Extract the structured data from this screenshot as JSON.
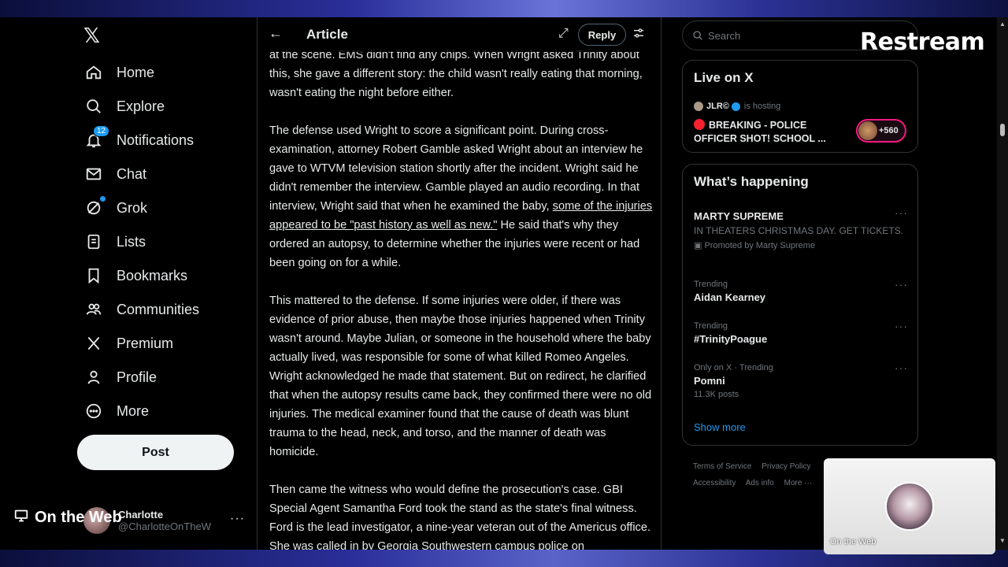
{
  "nav": {
    "items": [
      {
        "label": "Home",
        "icon": "home-icon"
      },
      {
        "label": "Explore",
        "icon": "search-icon"
      },
      {
        "label": "Notifications",
        "icon": "bell-icon",
        "badge": "12"
      },
      {
        "label": "Chat",
        "icon": "mail-icon"
      },
      {
        "label": "Grok",
        "icon": "grok-icon"
      },
      {
        "label": "Lists",
        "icon": "list-icon"
      },
      {
        "label": "Bookmarks",
        "icon": "bookmark-icon"
      },
      {
        "label": "Communities",
        "icon": "people-icon"
      },
      {
        "label": "Premium",
        "icon": "x-logo-icon"
      },
      {
        "label": "Profile",
        "icon": "person-icon"
      },
      {
        "label": "More",
        "icon": "more-circle-icon"
      }
    ],
    "post_label": "Post",
    "account": {
      "name": "Charlotte",
      "handle": "@CharlotteOnTheW"
    }
  },
  "article": {
    "header_title": "Article",
    "reply_label": "Reply",
    "p0": "at the scene. EMS didn't find any chips. When Wright asked Trinity about this, she gave a different story: the child wasn't really eating that morning, wasn't eating the night before either.",
    "p1_a": "The defense used Wright to score a significant point. During cross-examination, attorney Robert Gamble asked Wright about an interview he gave to WTVM television station shortly after the incident. Wright said he didn't remember the interview. Gamble played an audio recording. In that interview, Wright said that when he examined the baby, ",
    "p1_link": "some of the injuries appeared to be \"past history as well as new.\"",
    "p1_b": " He said that's why they ordered an autopsy, to determine whether the injuries were recent or had been going on for a while.",
    "p2": "This mattered to the defense. If some injuries were older, if there was evidence of prior abuse, then maybe those injuries happened when Trinity wasn't around. Maybe Julian, or someone in the household where the baby actually lived, was responsible for some of what killed Romeo Angeles. Wright acknowledged he made that statement. But on redirect, he clarified that when the autopsy results came back, they confirmed there were no old injuries. The medical examiner found that the cause of death was blunt trauma to the head, neck, and torso, and the manner of death was homicide.",
    "p3": "Then came the witness who would define the prosecution's case. GBI Special Agent Samantha Ford took the stand as the state's final witness. Ford is the lead investigator, a nine-year veteran out of the Americus office. She was called in by Georgia Southwestern campus police on"
  },
  "right": {
    "search_placeholder": "Search",
    "live": {
      "title": "Live on X",
      "host_name": "JLR©",
      "host_suffix": "is hosting",
      "text": "BREAKING - POLICE OFFICER SHOT! SCHOOL ...",
      "listeners": "+560"
    },
    "happening": {
      "title": "What’s happening",
      "trends": [
        {
          "name": "MARTY SUPREME",
          "desc": "IN THEATERS CHRISTMAS DAY. GET TICKETS.",
          "promo": "Promoted by Marty Supreme"
        },
        {
          "meta": "Trending",
          "name": "Aidan Kearney"
        },
        {
          "meta": "Trending",
          "name": "#TrinityPoague"
        },
        {
          "meta": "Only on X · Trending",
          "name": "Pomni",
          "count": "11.3K posts"
        }
      ],
      "show_more": "Show more"
    },
    "footer": {
      "terms": "Terms of Service",
      "privacy": "Privacy Policy",
      "accessibility": "Accessibility",
      "ads": "Ads info",
      "more": "More ···"
    }
  },
  "overlay": {
    "brand": "Restream",
    "show_name": "On the Web",
    "cam_label": "On the Web"
  },
  "colors": {
    "accent": "#1d9bf0",
    "live": "#f4212e",
    "ring": "#f91880"
  }
}
